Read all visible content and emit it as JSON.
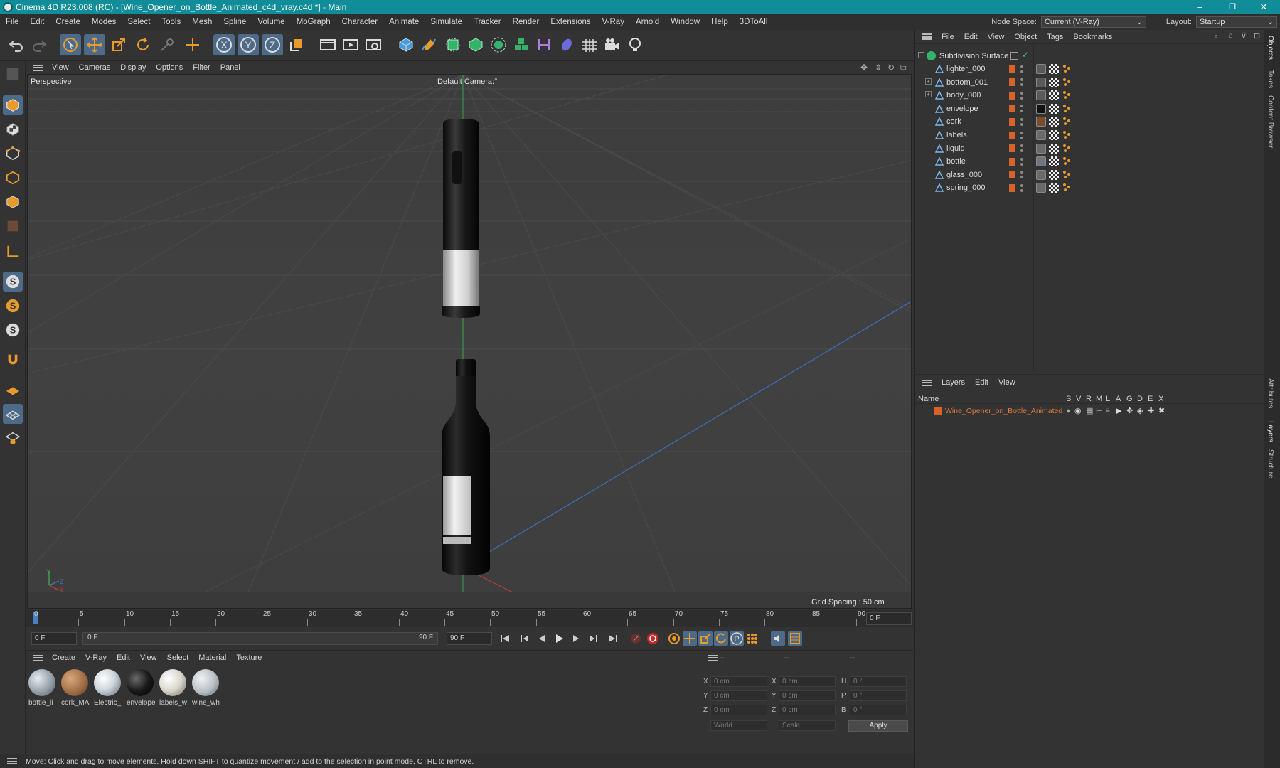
{
  "window": {
    "title": "Cinema 4D R23.008 (RC) - [Wine_Opener_on_Bottle_Animated_c4d_vray.c4d *] - Main",
    "controls": [
      "–",
      "❐",
      "✕"
    ]
  },
  "menu": {
    "items": [
      "File",
      "Edit",
      "Create",
      "Modes",
      "Select",
      "Tools",
      "Mesh",
      "Spline",
      "Volume",
      "MoGraph",
      "Character",
      "Animate",
      "Simulate",
      "Tracker",
      "Render",
      "Extensions",
      "V-Ray",
      "Arnold",
      "Window",
      "Help",
      "3DToAll"
    ],
    "node_space_label": "Node Space:",
    "node_space_value": "Current (V-Ray)",
    "layout_label": "Layout:",
    "layout_value": "Startup"
  },
  "viewport": {
    "menu": [
      "View",
      "Cameras",
      "Display",
      "Options",
      "Filter",
      "Panel"
    ],
    "view_name": "Perspective",
    "camera": "Default Camera",
    "camera_suffix": ":°",
    "grid_spacing": "Grid Spacing : 50 cm",
    "axis_labels": {
      "y": "Y",
      "z": "Z",
      "x": "X"
    }
  },
  "timeline": {
    "ticks": [
      "0",
      "5",
      "10",
      "15",
      "20",
      "25",
      "30",
      "35",
      "40",
      "45",
      "50",
      "55",
      "60",
      "65",
      "70",
      "75",
      "80",
      "85",
      "90"
    ],
    "current_frame": "0 F",
    "start_field": "0 F",
    "range_start": "0 F",
    "range_end": "90 F",
    "end_field": "90 F"
  },
  "materials": {
    "menu": [
      "Create",
      "V-Ray",
      "Edit",
      "View",
      "Select",
      "Material",
      "Texture"
    ],
    "items": [
      {
        "label": "bottle_li",
        "color": "#9aa4ad"
      },
      {
        "label": "cork_MA",
        "color": "#9b6a42"
      },
      {
        "label": "Electric_l",
        "color": "#cfd6dd"
      },
      {
        "label": "envelope",
        "color": "#1a1a1a"
      },
      {
        "label": "labels_w",
        "color": "#d9d5cc"
      },
      {
        "label": "wine_wh",
        "color": "#b7bec4"
      }
    ]
  },
  "attributes": {
    "header": [
      "--",
      "--",
      "--"
    ],
    "rows": [
      {
        "a": "X",
        "av": "0 cm",
        "b": "X",
        "bv": "0 cm",
        "c": "H",
        "cv": "0 °"
      },
      {
        "a": "Y",
        "av": "0 cm",
        "b": "Y",
        "bv": "0 cm",
        "c": "P",
        "cv": "0 °"
      },
      {
        "a": "Z",
        "av": "0 cm",
        "b": "Z",
        "bv": "0 cm",
        "c": "B",
        "cv": "0 °"
      }
    ],
    "coord_system": "World",
    "mode": "Scale",
    "apply_label": "Apply"
  },
  "status": {
    "text": "Move: Click and drag to move elements. Hold down SHIFT to quantize movement / add to the selection in point mode, CTRL to remove."
  },
  "objects": {
    "menu": [
      "File",
      "Edit",
      "View",
      "Object",
      "Tags",
      "Bookmarks"
    ],
    "root": "Subdivision Surface",
    "items": [
      {
        "name": "lighter_000",
        "expand": false,
        "tag": "#5a5a5a"
      },
      {
        "name": "bottom_001",
        "expand": true,
        "tag": "#5a5a5a"
      },
      {
        "name": "body_000",
        "expand": true,
        "tag": "#5a5a5a"
      },
      {
        "name": "envelope",
        "expand": false,
        "tag": "#111111"
      },
      {
        "name": "cork",
        "expand": false,
        "tag": "#7a4e2d"
      },
      {
        "name": "labels",
        "expand": false,
        "tag": "#6a6a6a"
      },
      {
        "name": "liquid",
        "expand": false,
        "tag": "#6a6a6a"
      },
      {
        "name": "bottle",
        "expand": false,
        "tag": "#6f7880"
      },
      {
        "name": "glass_000",
        "expand": false,
        "tag": "#6a6a6a"
      },
      {
        "name": "spring_000",
        "expand": false,
        "tag": "#6a6a6a"
      }
    ]
  },
  "layers": {
    "menu": [
      "Layers",
      "Edit",
      "View"
    ],
    "columns": [
      "Name",
      "S",
      "V",
      "R",
      "M",
      "L",
      "A",
      "G",
      "D",
      "E",
      "X"
    ],
    "items": [
      {
        "name": "Wine_Opener_on_Bottle_Animated",
        "color": "#d8632a"
      }
    ]
  },
  "sidetabs": [
    "Objects",
    "Takes",
    "Content Browser",
    "Attributes",
    "Layers",
    "Structure"
  ],
  "colors": {
    "accent": "#118d99",
    "highlight": "#4d6a89",
    "layer": "#d8632a"
  }
}
